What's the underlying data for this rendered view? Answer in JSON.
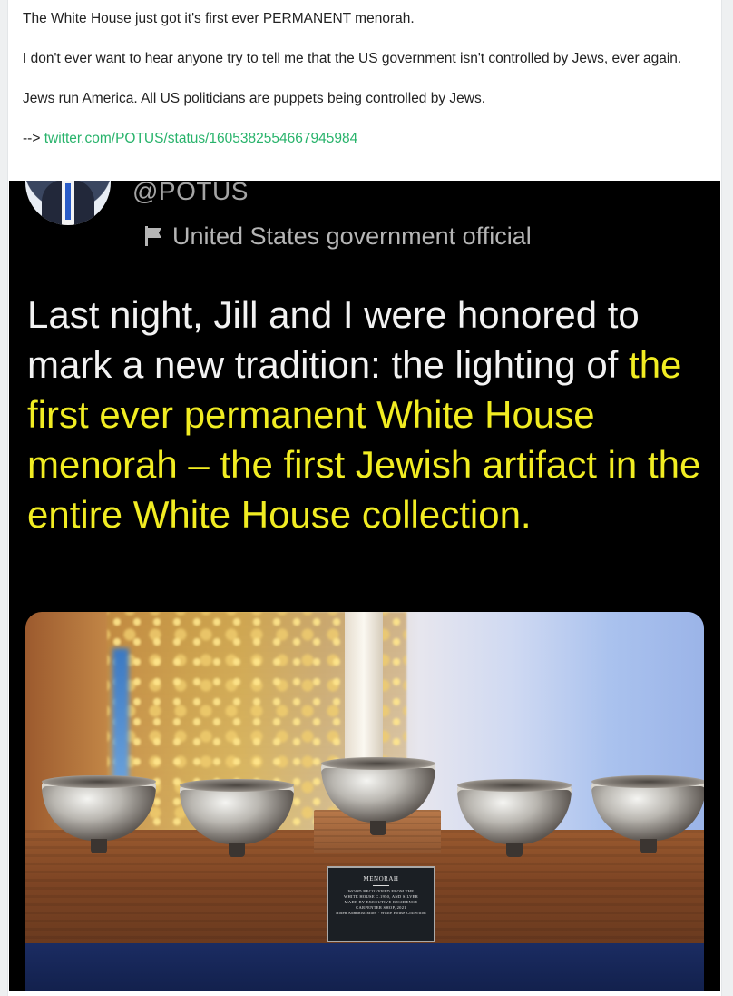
{
  "post": {
    "paragraphs": [
      "The White House just got it's first ever PERMANENT menorah.",
      "I don't ever want to hear anyone try to tell me that the US government isn't controlled by Jews, ever again.",
      "Jews run America. All US politicians are puppets being controlled by Jews."
    ],
    "link_prefix": "-->",
    "link_text": "twitter.com/POTUS/status/1605382554667945984"
  },
  "tweet": {
    "handle": "@POTUS",
    "official_label": "United States government official",
    "text_plain": "Last night, Jill and I were honored to mark a new tradition: the lighting of",
    "text_highlight": "the first ever permanent White House menorah – the first Jewish artifact in the entire White House collection."
  },
  "plaque": {
    "title": "MENORAH",
    "lines": [
      "WOOD RECOVERED FROM THE",
      "WHITE HOUSE C.1950, AND SILVER",
      "MADE BY EXECUTIVE RESIDENCE",
      "CARPENTER SHOP, 2021",
      "Biden Administration · White House Collection"
    ]
  },
  "colors": {
    "link": "#28b36b",
    "tweet_text": "#f2f2f2",
    "tweet_highlight": "#f1ec22",
    "tweet_background": "#000000"
  },
  "icons": [
    "flag-icon"
  ]
}
